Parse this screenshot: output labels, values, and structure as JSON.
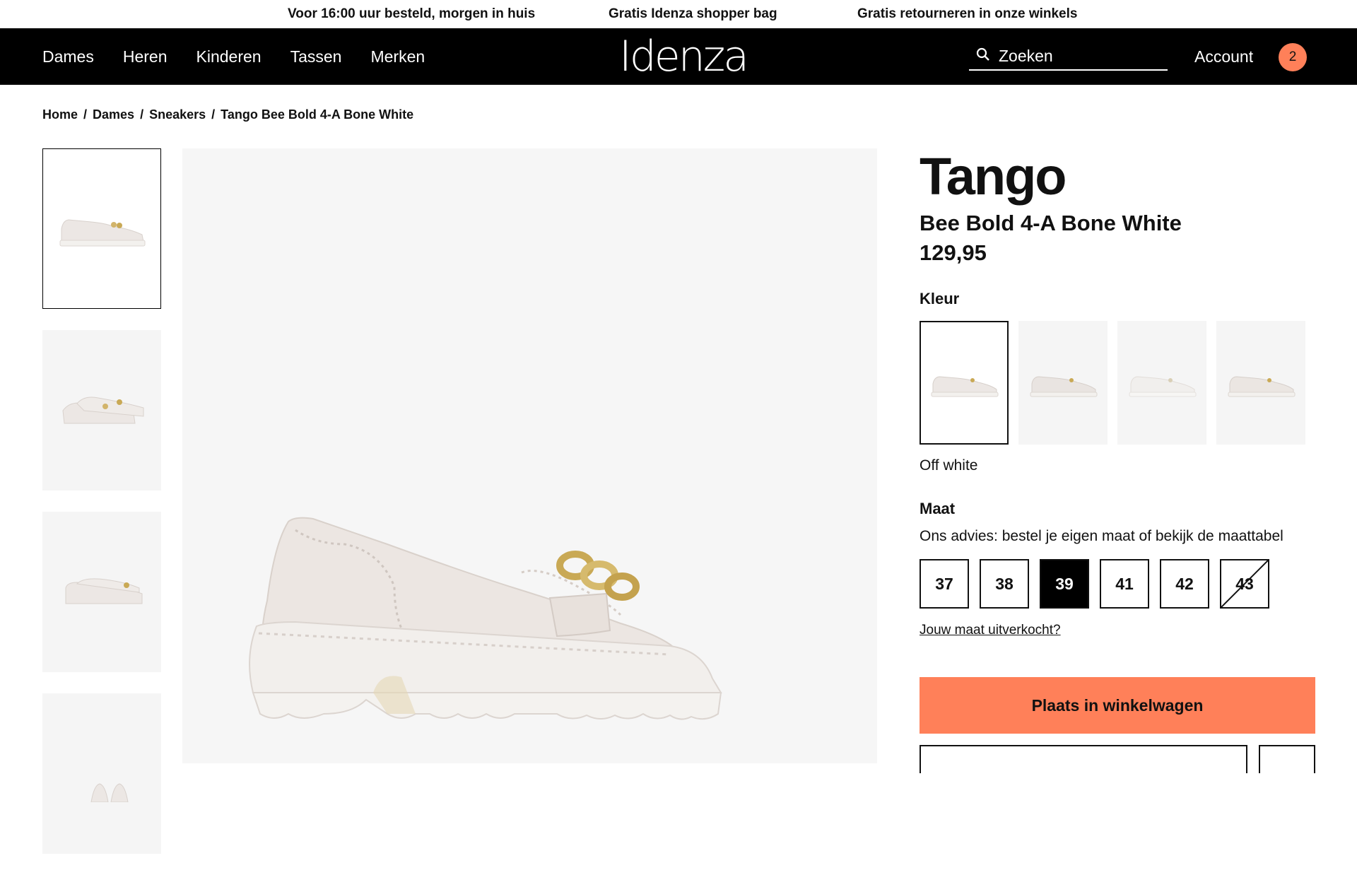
{
  "announcements": [
    "Voor 16:00 uur besteld, morgen in huis",
    "Gratis Idenza shopper bag",
    "Gratis retourneren in onze winkels"
  ],
  "nav": [
    "Dames",
    "Heren",
    "Kinderen",
    "Tassen",
    "Merken"
  ],
  "logo": "Idenza",
  "search": {
    "placeholder": "Zoeken"
  },
  "account_label": "Account",
  "cart_count": "2",
  "breadcrumb": [
    "Home",
    "Dames",
    "Sneakers",
    "Tango Bee Bold 4-A Bone White"
  ],
  "product": {
    "brand": "Tango",
    "model": "Bee Bold 4-A Bone White",
    "price": "129,95"
  },
  "color": {
    "label": "Kleur",
    "selected_name": "Off white",
    "swatch_count": 4
  },
  "size": {
    "label": "Maat",
    "advice": "Ons advies: bestel je eigen maat of bekijk de maattabel",
    "options": [
      {
        "label": "37",
        "state": "available"
      },
      {
        "label": "38",
        "state": "available"
      },
      {
        "label": "39",
        "state": "selected"
      },
      {
        "label": "41",
        "state": "available"
      },
      {
        "label": "42",
        "state": "available"
      },
      {
        "label": "43",
        "state": "soldout"
      }
    ],
    "soldout_link": "Jouw maat uitverkocht?"
  },
  "cta_label": "Plaats in winkelwagen",
  "colors": {
    "accent": "#ff8059",
    "header_bg": "#000000",
    "image_bg": "#f6f6f6"
  }
}
